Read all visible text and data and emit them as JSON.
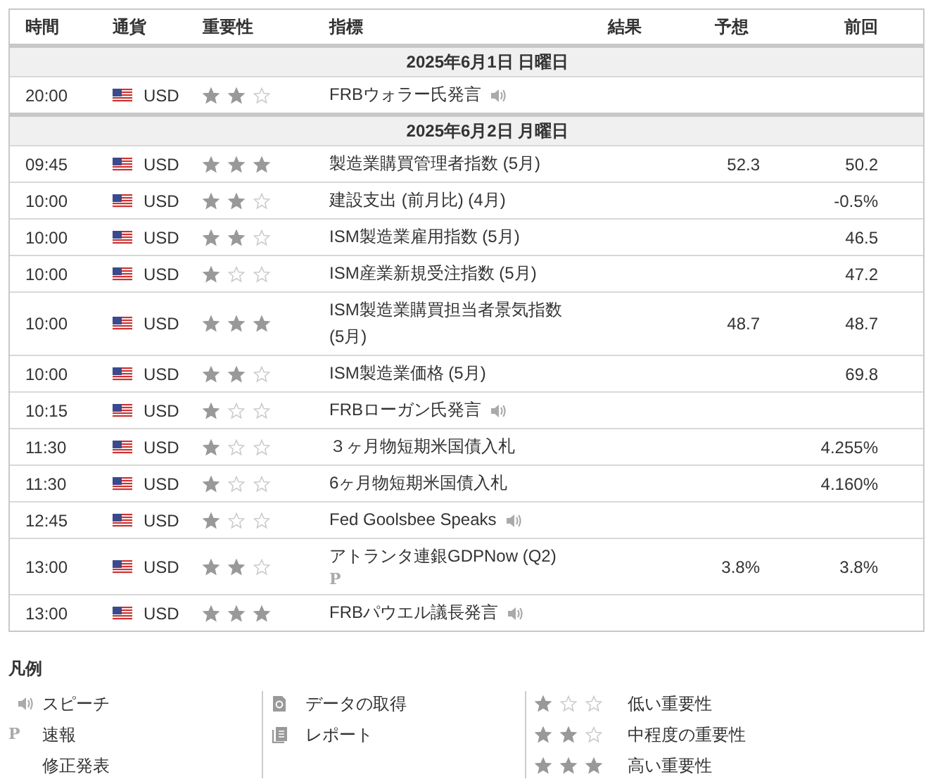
{
  "table": {
    "columns": [
      "時間",
      "通貨",
      "重要性",
      "指標",
      "結果",
      "予想",
      "前回"
    ],
    "groups": [
      {
        "date": "2025年6月1日 日曜日",
        "events": [
          {
            "time": "20:00",
            "currency": "USD",
            "stars": 2,
            "title": "FRBウォラー氏発言",
            "kind": "speech"
          }
        ]
      },
      {
        "date": "2025年6月2日 月曜日",
        "events": [
          {
            "time": "09:45",
            "currency": "USD",
            "stars": 3,
            "title": "製造業購買管理者指数 (5月)",
            "forecast": "52.3",
            "previous": "50.2"
          },
          {
            "time": "10:00",
            "currency": "USD",
            "stars": 2,
            "title": "建設支出 (前月比) (4月)",
            "previous": "-0.5%"
          },
          {
            "time": "10:00",
            "currency": "USD",
            "stars": 2,
            "title": "ISM製造業雇用指数 (5月)",
            "previous": "46.5"
          },
          {
            "time": "10:00",
            "currency": "USD",
            "stars": 1,
            "title": "ISM産業新規受注指数 (5月)",
            "previous": "47.2"
          },
          {
            "time": "10:00",
            "currency": "USD",
            "stars": 3,
            "title": "ISM製造業購買担当者景気指数 (5月)",
            "forecast": "48.7",
            "previous": "48.7"
          },
          {
            "time": "10:00",
            "currency": "USD",
            "stars": 2,
            "title": "ISM製造業価格 (5月)",
            "previous": "69.8"
          },
          {
            "time": "10:15",
            "currency": "USD",
            "stars": 1,
            "title": "FRBローガン氏発言",
            "kind": "speech"
          },
          {
            "time": "11:30",
            "currency": "USD",
            "stars": 1,
            "title": "３ヶ月物短期米国債入札",
            "previous": "4.255%"
          },
          {
            "time": "11:30",
            "currency": "USD",
            "stars": 1,
            "title": "6ヶ月物短期米国債入札",
            "previous": "4.160%"
          },
          {
            "time": "12:45",
            "currency": "USD",
            "stars": 1,
            "title": "Fed Goolsbee Speaks",
            "kind": "speech"
          },
          {
            "time": "13:00",
            "currency": "USD",
            "stars": 2,
            "title": "アトランタ連銀GDPNow (Q2)",
            "badge": "P",
            "forecast": "3.8%",
            "previous": "3.8%"
          },
          {
            "time": "13:00",
            "currency": "USD",
            "stars": 3,
            "title": "FRBパウエル議長発言",
            "kind": "speech"
          }
        ]
      }
    ]
  },
  "legend": {
    "title": "凡例",
    "columns": [
      [
        {
          "kind": "speech",
          "label": "スピーチ"
        },
        {
          "kind": "badge",
          "badge": "P",
          "label": "速報"
        },
        {
          "kind": "none",
          "label": "修正発表"
        }
      ],
      [
        {
          "kind": "data",
          "label": "データの取得"
        },
        {
          "kind": "report",
          "label": "レポート"
        }
      ],
      [
        {
          "kind": "stars",
          "stars": 1,
          "label": "低い重要性"
        },
        {
          "kind": "stars",
          "stars": 2,
          "label": "中程度の重要性"
        },
        {
          "kind": "stars",
          "stars": 3,
          "label": "高い重要性"
        }
      ]
    ]
  }
}
